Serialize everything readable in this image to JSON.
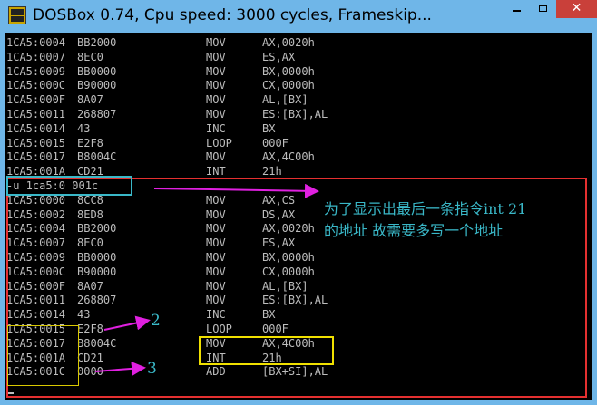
{
  "window": {
    "title": "DOSBox 0.74, Cpu speed:     3000 cycles, Frameskip...",
    "minimize_symbol": "—",
    "maximize_symbol": "□",
    "close_symbol": "✕"
  },
  "colors": {
    "titlebar": "#6fb6e8",
    "screen_bg": "#000000",
    "screen_text": "#bdbdbd",
    "annotation_cyan": "#3ab8c8",
    "arrow_magenta": "#e020e0",
    "box_red": "#e53030",
    "box_yellow": "#f0e000"
  },
  "console": {
    "lines": [
      {
        "addr": "1CA5:0004",
        "hex": "BB2000",
        "op": "MOV",
        "arg": "AX,0020h"
      },
      {
        "addr": "1CA5:0007",
        "hex": "8EC0",
        "op": "MOV",
        "arg": "ES,AX"
      },
      {
        "addr": "1CA5:0009",
        "hex": "BB0000",
        "op": "MOV",
        "arg": "BX,0000h"
      },
      {
        "addr": "1CA5:000C",
        "hex": "B90000",
        "op": "MOV",
        "arg": "CX,0000h"
      },
      {
        "addr": "1CA5:000F",
        "hex": "8A07",
        "op": "MOV",
        "arg": "AL,[BX]"
      },
      {
        "addr": "1CA5:0011",
        "hex": "268807",
        "op": "MOV",
        "arg": "ES:[BX],AL"
      },
      {
        "addr": "1CA5:0014",
        "hex": "43",
        "op": "INC",
        "arg": "BX"
      },
      {
        "addr": "1CA5:0015",
        "hex": "E2F8",
        "op": "LOOP",
        "arg": "000F"
      },
      {
        "addr": "1CA5:0017",
        "hex": "B8004C",
        "op": "MOV",
        "arg": "AX,4C00h"
      },
      {
        "addr": "1CA5:001A",
        "hex": "CD21",
        "op": "INT",
        "arg": "21h"
      },
      {
        "addr": "-u 1ca5:0 001c",
        "hex": "",
        "op": "",
        "arg": ""
      },
      {
        "addr": "1CA5:0000",
        "hex": "8CC8",
        "op": "MOV",
        "arg": "AX,CS"
      },
      {
        "addr": "1CA5:0002",
        "hex": "8ED8",
        "op": "MOV",
        "arg": "DS,AX"
      },
      {
        "addr": "1CA5:0004",
        "hex": "BB2000",
        "op": "MOV",
        "arg": "AX,0020h"
      },
      {
        "addr": "1CA5:0007",
        "hex": "8EC0",
        "op": "MOV",
        "arg": "ES,AX"
      },
      {
        "addr": "1CA5:0009",
        "hex": "BB0000",
        "op": "MOV",
        "arg": "BX,0000h"
      },
      {
        "addr": "1CA5:000C",
        "hex": "B90000",
        "op": "MOV",
        "arg": "CX,0000h"
      },
      {
        "addr": "1CA5:000F",
        "hex": "8A07",
        "op": "MOV",
        "arg": "AL,[BX]"
      },
      {
        "addr": "1CA5:0011",
        "hex": "268807",
        "op": "MOV",
        "arg": "ES:[BX],AL"
      },
      {
        "addr": "1CA5:0014",
        "hex": "43",
        "op": "INC",
        "arg": "BX"
      },
      {
        "addr": "1CA5:0015",
        "hex": "E2F8",
        "op": "LOOP",
        "arg": "000F"
      },
      {
        "addr": "1CA5:0017",
        "hex": "B8004C",
        "op": "MOV",
        "arg": "AX,4C00h"
      },
      {
        "addr": "1CA5:001A",
        "hex": "CD21",
        "op": "INT",
        "arg": "21h"
      },
      {
        "addr": "1CA5:001C",
        "hex": "0000",
        "op": "ADD",
        "arg": "[BX+SI],AL"
      }
    ],
    "prompt": "-"
  },
  "annotations": {
    "note_line1": "为了显示出最后一条指令int 21",
    "note_line2": "的地址 故需要多写一个地址",
    "marker_2": "2",
    "marker_3": "3"
  }
}
